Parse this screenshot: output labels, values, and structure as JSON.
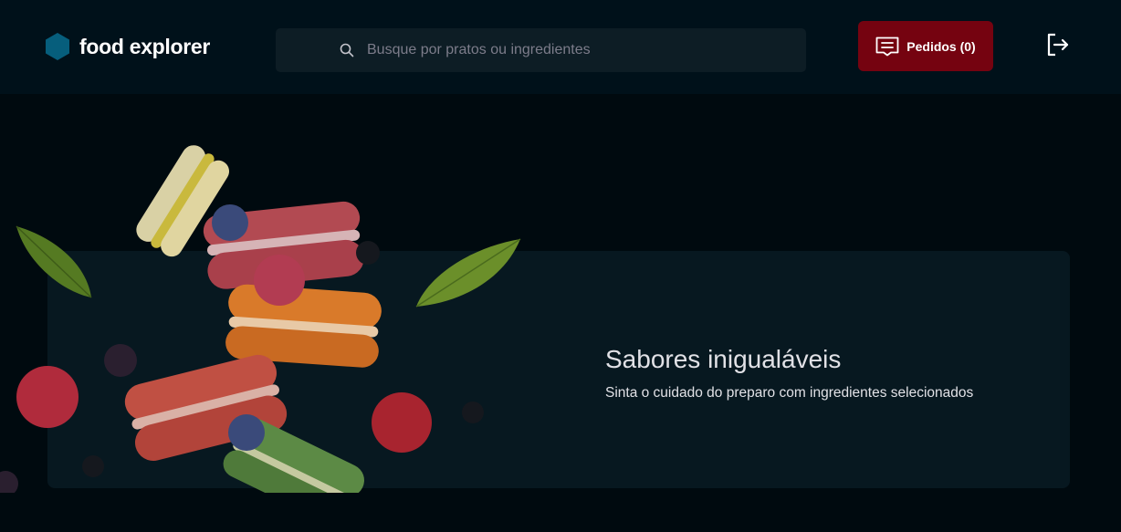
{
  "header": {
    "logo_text": "food explorer",
    "search_placeholder": "Busque por pratos ou ingredientes",
    "orders_label": "Pedidos (0)"
  },
  "banner": {
    "title": "Sabores inigualáveis",
    "subtitle": "Sinta o cuidado do preparo com ingredientes selecionados"
  },
  "colors": {
    "page_background": "#000a0f",
    "header_background": "#00111a",
    "banner_background": "#071820",
    "orders_button": "#750310",
    "logo_hexagon": "#065e7c"
  },
  "icons": {
    "logo": "hexagon-icon",
    "search": "search-icon",
    "orders": "receipt-icon",
    "logout": "sign-out-icon"
  }
}
